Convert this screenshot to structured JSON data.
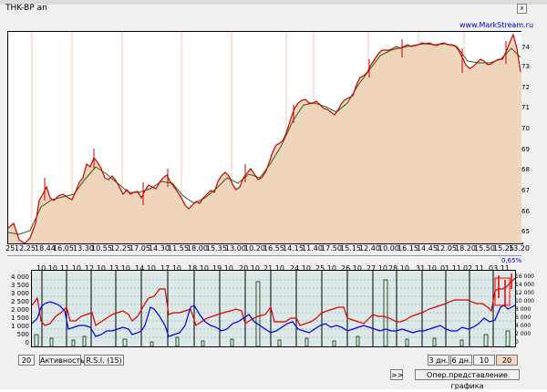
{
  "window": {
    "title": "THK-BP an",
    "close_label": "x"
  },
  "watermark": "www.MarkStream.ru",
  "main_chart": {
    "y_ticks": [
      "74",
      "73",
      "72",
      "71",
      "70",
      "69",
      "68",
      "67",
      "66",
      "65"
    ],
    "x_ticks": [
      "25",
      "12.25",
      "18.44",
      "16.05",
      "13.30",
      "10.55",
      "12.25",
      "17.05",
      "14.30",
      "11.55",
      "18.00",
      "15.35",
      "13.00",
      "10.20",
      "16.55",
      "14.15",
      "11.40",
      "17.50",
      "15.15",
      "12.40",
      "10.00",
      "16.15",
      "14.45",
      "12.05",
      "18.20",
      "15.50",
      "15.25",
      "13.20"
    ]
  },
  "indicator": {
    "percent_label": "0,65%",
    "date_labels": [
      "10.10",
      "11.10",
      "12.10",
      "13.10",
      "14.10",
      "17.10",
      "18.10",
      "19.10",
      "20.10",
      "21.10",
      "24.10",
      "25.10",
      "26.10",
      "27.10",
      "28.10",
      "31.10",
      "01.11",
      "02.11",
      "03.11"
    ],
    "left_ticks": [
      "4 000",
      "3 500",
      "3 000",
      "2 500",
      "2 000",
      "1 500",
      "1 000",
      "500",
      "0"
    ],
    "right_ticks": [
      "16 000",
      "14 000",
      "12 000",
      "10 000",
      "8 000",
      "6 000",
      "4 000",
      "2 000",
      "0"
    ]
  },
  "controls": {
    "period_value": "20",
    "activity_label": "Активность",
    "rsi_label": "R.S.I.",
    "rsi_value": "(15)",
    "ranges": [
      "3 дн.",
      "6 дн.",
      "10 дн.",
      "20 дн."
    ],
    "active_range": "20 дн.",
    "next_label": ">>",
    "oper_label": "Опер.представление графика"
  },
  "colors": {
    "price_line": "#cc0000",
    "area_fill": "#efd5bb",
    "ma_line": "#2e5e1e",
    "blue_series": "#0000dd",
    "red_series": "#dd0000",
    "lower_bg": "#dde8e8"
  }
}
